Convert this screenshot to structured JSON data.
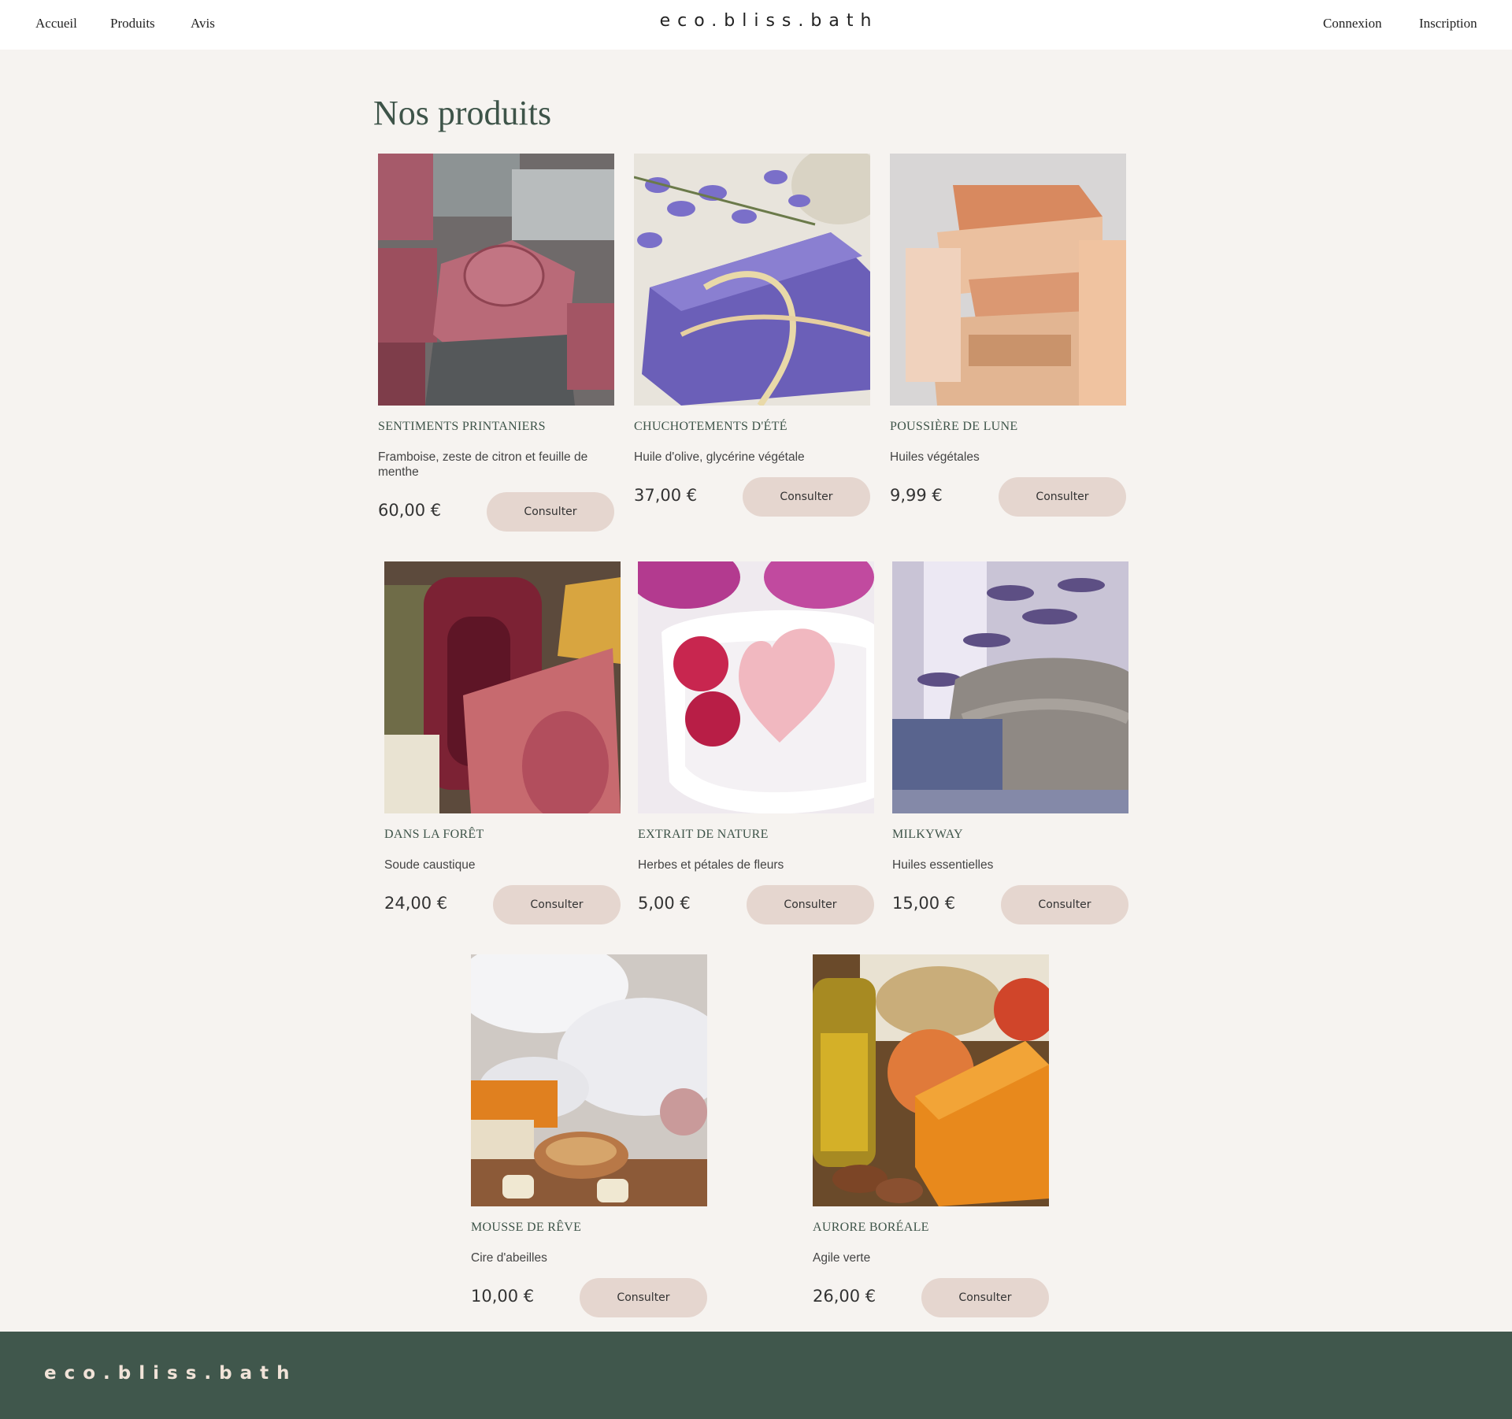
{
  "nav": {
    "left": [
      "Accueil",
      "Produits",
      "Avis"
    ],
    "brand": "eco.bliss.bath",
    "right": [
      "Connexion",
      "Inscription"
    ]
  },
  "main": {
    "title": "Nos produits",
    "button_label": "Consulter",
    "products": [
      {
        "name": "SENTIMENTS PRINTANIERS",
        "desc": "Framboise, zeste de citron et feuille de menthe",
        "price": "60,00 €",
        "image": "stacked pink and grey stamped soaps"
      },
      {
        "name": "CHUCHOTEMENTS D'ÉTÉ",
        "desc": "Huile d'olive, glycérine végétale",
        "price": "37,00 €",
        "image": "lavender soap tied with raffia"
      },
      {
        "name": "POUSSIÈRE DE LUNE",
        "desc": "Huiles végétales",
        "price": "9,99 €",
        "image": "stack of peach soap bars"
      },
      {
        "name": "DANS LA FORÊT",
        "desc": "Soude caustique",
        "price": "24,00 €",
        "image": "assorted colorful soap bars"
      },
      {
        "name": "EXTRAIT DE NATURE",
        "desc": "Herbes et pétales de fleurs",
        "price": "5,00 €",
        "image": "heart soap with raspberries"
      },
      {
        "name": "MILKYWAY",
        "desc": "Huiles essentielles",
        "price": "15,00 €",
        "image": "lavender soap on towel"
      },
      {
        "name": "MOUSSE DE RÊVE",
        "desc": "Cire d'abeilles",
        "price": "10,00 €",
        "image": "white towels with soaps and spoon"
      },
      {
        "name": "AURORE BORÉALE",
        "desc": "Agile verte",
        "price": "26,00 €",
        "image": "orange soap with apricots and oil"
      }
    ]
  },
  "footer": {
    "brand": "eco.bliss.bath"
  }
}
